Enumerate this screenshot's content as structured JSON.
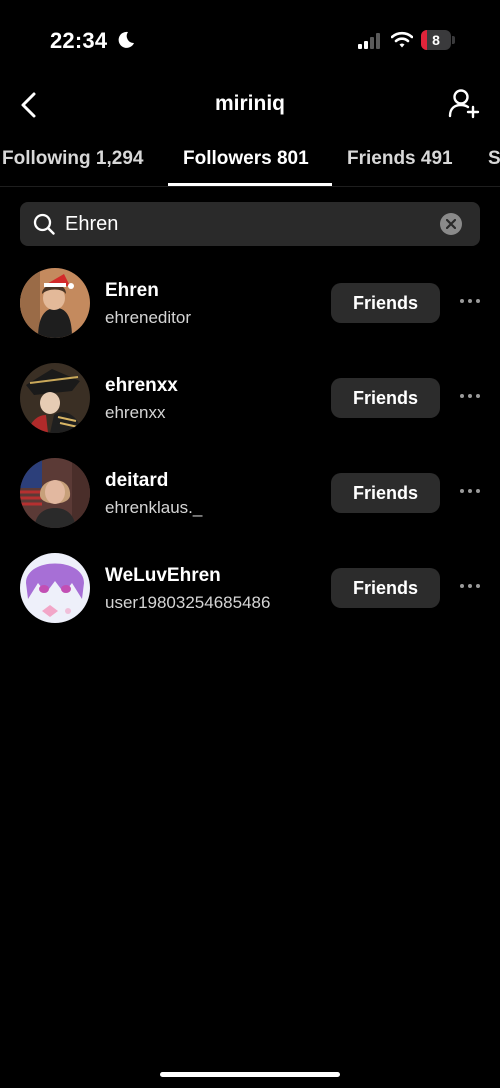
{
  "status_bar": {
    "time": "22:34",
    "battery": "8",
    "battery_level": 0.08,
    "battery_color": "#e0243a"
  },
  "header": {
    "title": "miriniq"
  },
  "tabs": [
    {
      "label": "Following 1,294"
    },
    {
      "label": "Followers 801",
      "active": true
    },
    {
      "label": "Friends 491"
    },
    {
      "label": "S"
    }
  ],
  "search": {
    "value": "Ehren"
  },
  "results": [
    {
      "name": "Ehren",
      "handle": "ehreneditor",
      "button": "Friends"
    },
    {
      "name": "ehrenxx",
      "handle": "ehrenxx",
      "button": "Friends"
    },
    {
      "name": "deitard",
      "handle": "ehrenklaus._",
      "button": "Friends"
    },
    {
      "name": "WeLuvEhren",
      "handle": "user19803254685486",
      "button": "Friends"
    }
  ]
}
